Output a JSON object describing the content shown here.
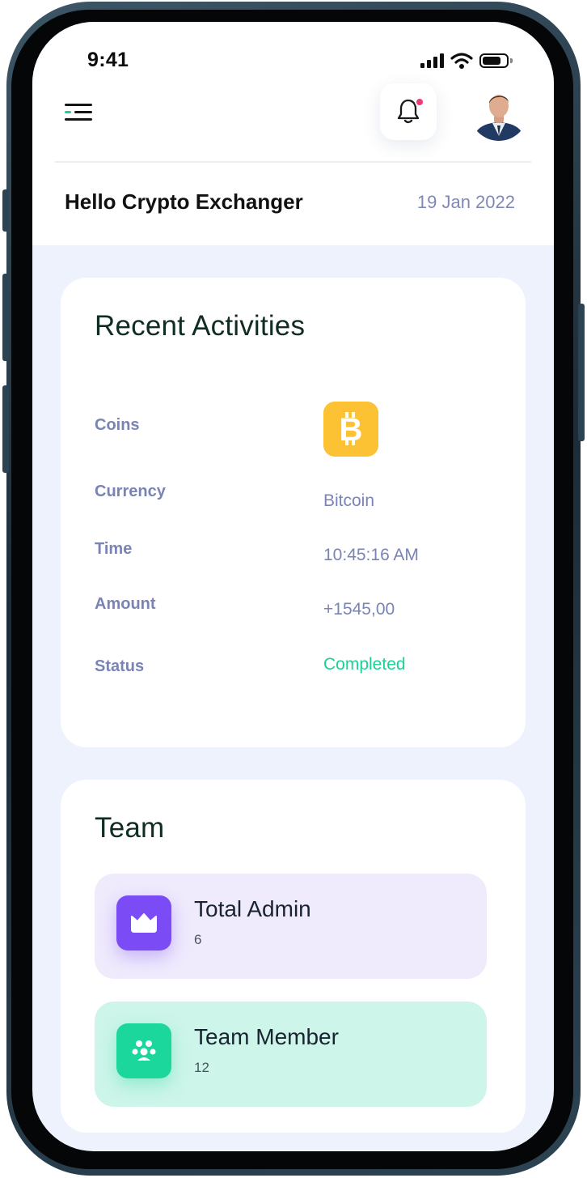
{
  "status_bar": {
    "time": "9:41"
  },
  "header": {
    "greeting": "Hello Crypto Exchanger",
    "date": "19 Jan 2022"
  },
  "recent_activities": {
    "title": "Recent Activities",
    "rows": [
      {
        "label": "Coins",
        "value": ""
      },
      {
        "label": "Currency",
        "value": "Bitcoin"
      },
      {
        "label": "Time",
        "value": "10:45:16 AM"
      },
      {
        "label": "Amount",
        "value": "+1545,00"
      },
      {
        "label": "Status",
        "value": "Completed"
      }
    ],
    "coin_icon": "bitcoin-icon"
  },
  "team": {
    "title": "Team",
    "items": [
      {
        "name": "Total Admin",
        "count": "6",
        "icon": "crown-icon"
      },
      {
        "name": "Team Member",
        "count": "12",
        "icon": "group-icon"
      }
    ]
  },
  "colors": {
    "background": "#eef2fd",
    "label": "#7a84b4",
    "status_completed": "#1ad296",
    "bitcoin": "#fcc234",
    "admin_accent": "#7b4cf5",
    "member_accent": "#1cd79c",
    "notification_dot": "#ec3b7b"
  }
}
